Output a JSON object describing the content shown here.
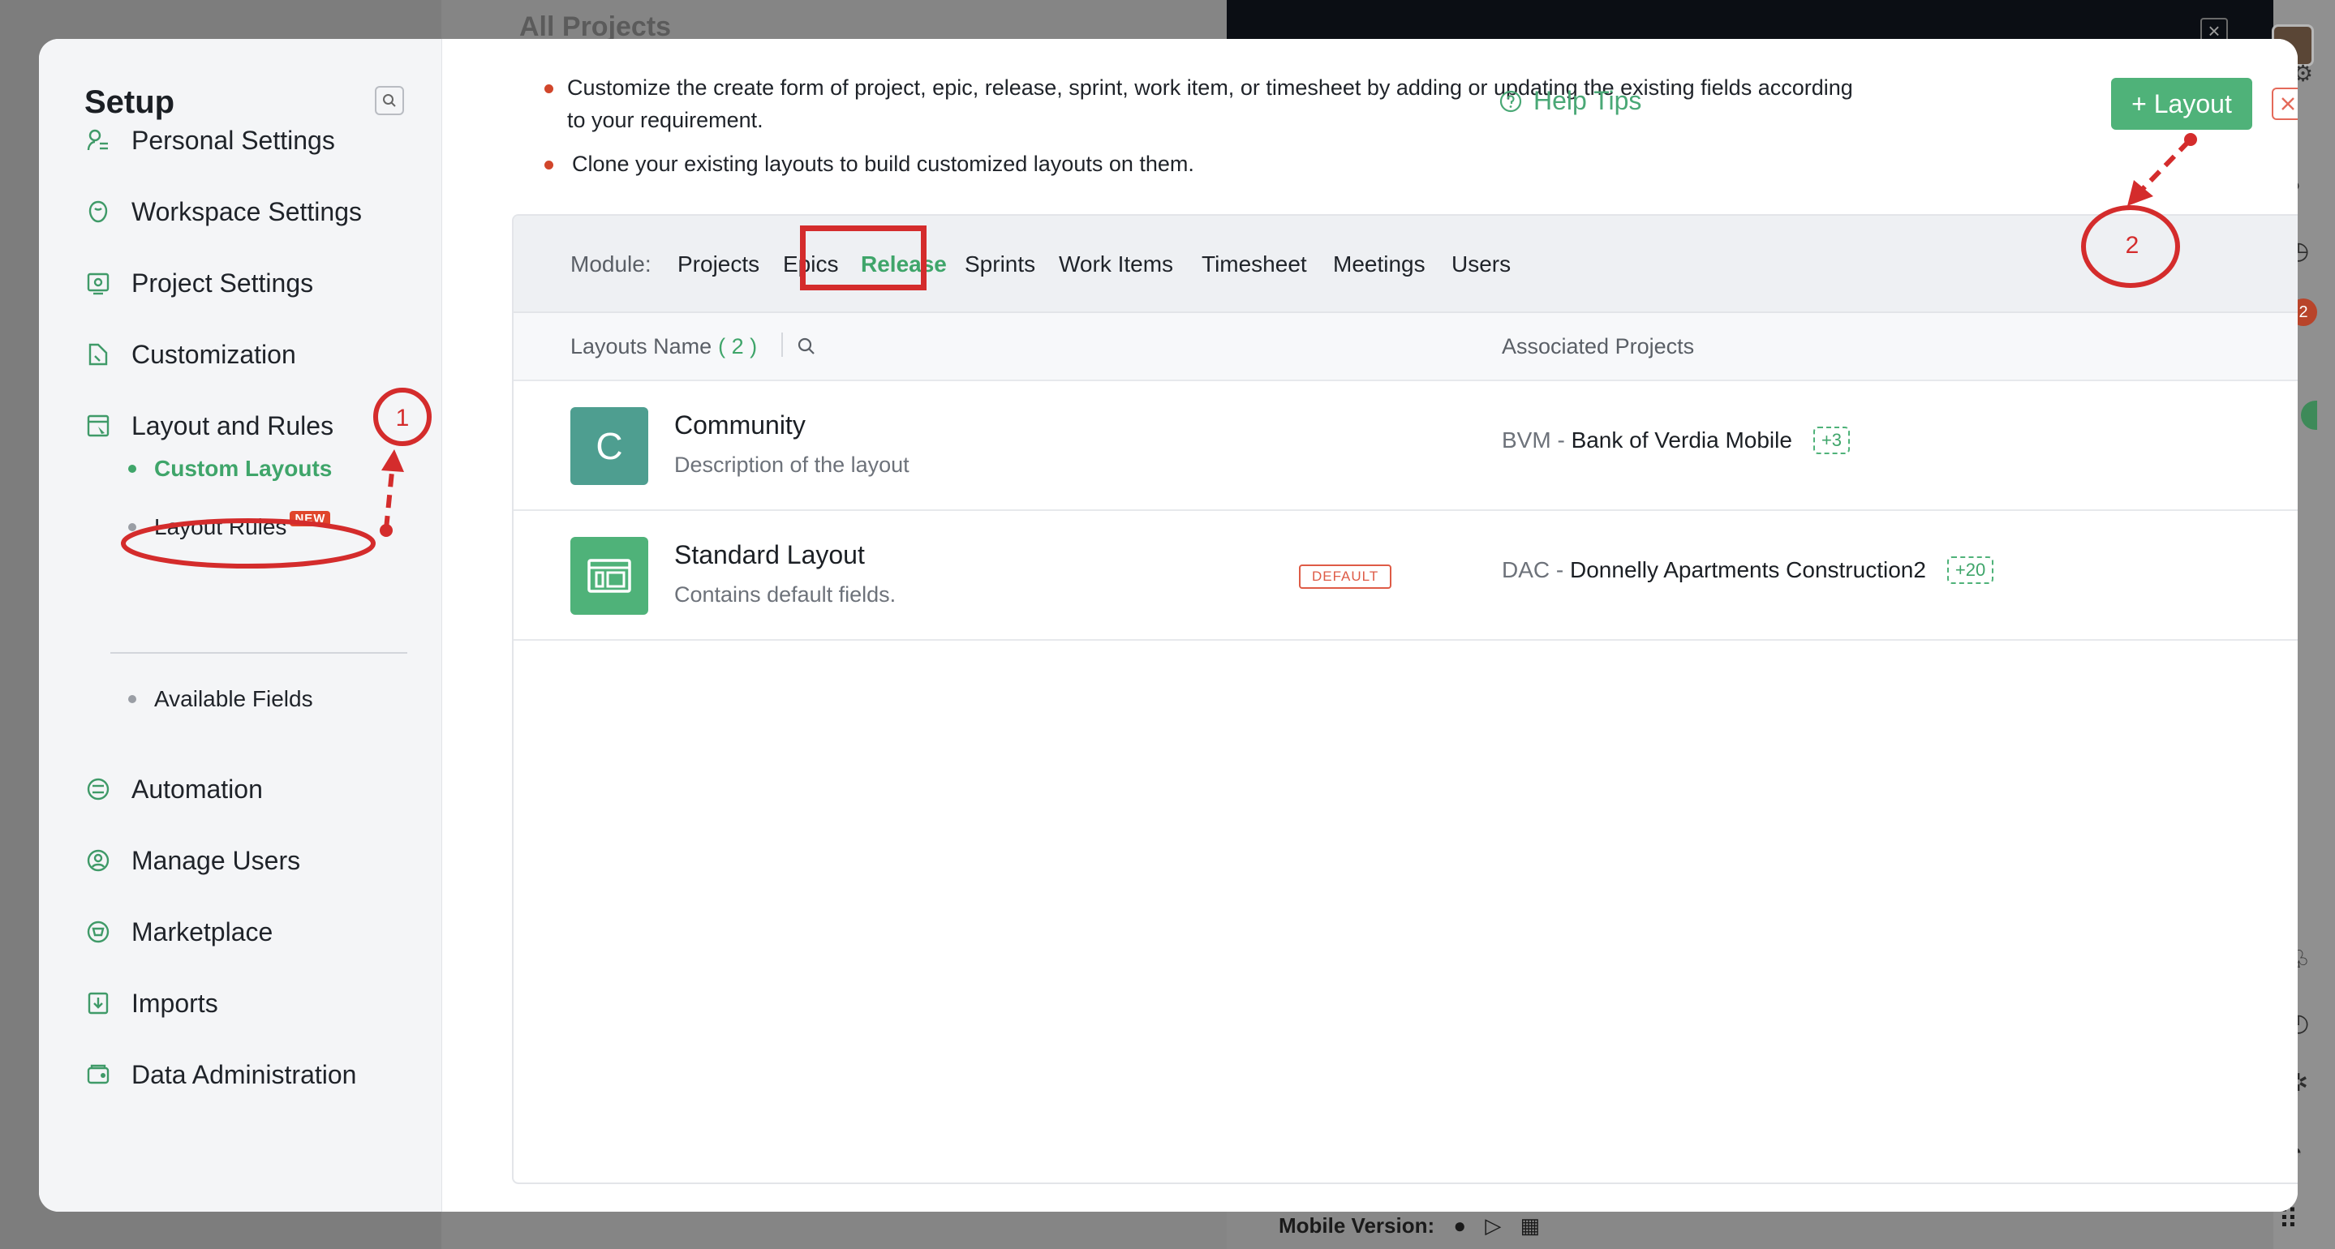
{
  "background": {
    "page_title": "All Projects",
    "mobile_version_label": "Mobile Version:",
    "rail_badge": "2"
  },
  "sidebar": {
    "title": "Setup",
    "items": [
      {
        "label": "Personal Settings",
        "icon": "personal-settings-icon"
      },
      {
        "label": "Workspace Settings",
        "icon": "workspace-settings-icon"
      },
      {
        "label": "Project Settings",
        "icon": "project-settings-icon"
      },
      {
        "label": "Customization",
        "icon": "customization-icon"
      },
      {
        "label": "Layout and Rules",
        "icon": "layout-rules-icon"
      },
      {
        "label": "Automation",
        "icon": "automation-icon"
      },
      {
        "label": "Manage Users",
        "icon": "manage-users-icon"
      },
      {
        "label": "Marketplace",
        "icon": "marketplace-icon"
      },
      {
        "label": "Imports",
        "icon": "imports-icon"
      },
      {
        "label": "Data Administration",
        "icon": "data-administration-icon"
      }
    ],
    "sub_items": [
      {
        "label": "Custom Layouts",
        "active": true
      },
      {
        "label": "Layout Rules",
        "badge": "NEW"
      },
      {
        "label": "Available Fields"
      }
    ]
  },
  "header": {
    "bullets": [
      "Customize the create form of project, epic, release, sprint, work item, or timesheet by adding or updating the existing fields according",
      "to your requirement.",
      "Clone your existing layouts to build customized layouts on them."
    ],
    "help_tips_label": "Help Tips",
    "add_layout_label": "+ Layout"
  },
  "modules": {
    "label": "Module:",
    "tabs": [
      "Projects",
      "Epics",
      "Release",
      "Sprints",
      "Work Items",
      "Timesheet",
      "Meetings",
      "Users"
    ],
    "active": "Release"
  },
  "table": {
    "col_name": "Layouts Name",
    "count": "( 2 )",
    "col_assoc": "Associated Projects",
    "rows": [
      {
        "icon_letter": "C",
        "icon_color": "#4e9e90",
        "title": "Community",
        "description": "Description of the layout",
        "badge": "",
        "project_code": "BVM -",
        "project_name": "Bank of Verdia Mobile",
        "more": "+3"
      },
      {
        "icon_letter": "",
        "icon_color": "#4fb279",
        "title": "Standard Layout",
        "description": "Contains default fields.",
        "badge": "DEFAULT",
        "project_code": "DAC -",
        "project_name": "Donnelly Apartments Construction2",
        "more": "+20"
      }
    ]
  },
  "annotations": [
    "1",
    "2"
  ],
  "colors": {
    "accent": "#3fa56a",
    "button": "#4fb279",
    "danger": "#d42c2c"
  }
}
